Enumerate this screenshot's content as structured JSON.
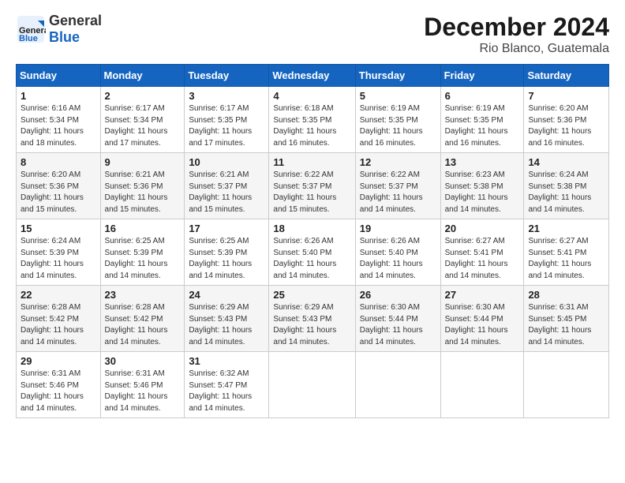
{
  "header": {
    "logo_general": "General",
    "logo_blue": "Blue",
    "title": "December 2024",
    "subtitle": "Rio Blanco, Guatemala"
  },
  "days_of_week": [
    "Sunday",
    "Monday",
    "Tuesday",
    "Wednesday",
    "Thursday",
    "Friday",
    "Saturday"
  ],
  "weeks": [
    [
      {
        "day": "1",
        "info": "Sunrise: 6:16 AM\nSunset: 5:34 PM\nDaylight: 11 hours\nand 18 minutes."
      },
      {
        "day": "2",
        "info": "Sunrise: 6:17 AM\nSunset: 5:34 PM\nDaylight: 11 hours\nand 17 minutes."
      },
      {
        "day": "3",
        "info": "Sunrise: 6:17 AM\nSunset: 5:35 PM\nDaylight: 11 hours\nand 17 minutes."
      },
      {
        "day": "4",
        "info": "Sunrise: 6:18 AM\nSunset: 5:35 PM\nDaylight: 11 hours\nand 16 minutes."
      },
      {
        "day": "5",
        "info": "Sunrise: 6:19 AM\nSunset: 5:35 PM\nDaylight: 11 hours\nand 16 minutes."
      },
      {
        "day": "6",
        "info": "Sunrise: 6:19 AM\nSunset: 5:35 PM\nDaylight: 11 hours\nand 16 minutes."
      },
      {
        "day": "7",
        "info": "Sunrise: 6:20 AM\nSunset: 5:36 PM\nDaylight: 11 hours\nand 16 minutes."
      }
    ],
    [
      {
        "day": "8",
        "info": "Sunrise: 6:20 AM\nSunset: 5:36 PM\nDaylight: 11 hours\nand 15 minutes."
      },
      {
        "day": "9",
        "info": "Sunrise: 6:21 AM\nSunset: 5:36 PM\nDaylight: 11 hours\nand 15 minutes."
      },
      {
        "day": "10",
        "info": "Sunrise: 6:21 AM\nSunset: 5:37 PM\nDaylight: 11 hours\nand 15 minutes."
      },
      {
        "day": "11",
        "info": "Sunrise: 6:22 AM\nSunset: 5:37 PM\nDaylight: 11 hours\nand 15 minutes."
      },
      {
        "day": "12",
        "info": "Sunrise: 6:22 AM\nSunset: 5:37 PM\nDaylight: 11 hours\nand 14 minutes."
      },
      {
        "day": "13",
        "info": "Sunrise: 6:23 AM\nSunset: 5:38 PM\nDaylight: 11 hours\nand 14 minutes."
      },
      {
        "day": "14",
        "info": "Sunrise: 6:24 AM\nSunset: 5:38 PM\nDaylight: 11 hours\nand 14 minutes."
      }
    ],
    [
      {
        "day": "15",
        "info": "Sunrise: 6:24 AM\nSunset: 5:39 PM\nDaylight: 11 hours\nand 14 minutes."
      },
      {
        "day": "16",
        "info": "Sunrise: 6:25 AM\nSunset: 5:39 PM\nDaylight: 11 hours\nand 14 minutes."
      },
      {
        "day": "17",
        "info": "Sunrise: 6:25 AM\nSunset: 5:39 PM\nDaylight: 11 hours\nand 14 minutes."
      },
      {
        "day": "18",
        "info": "Sunrise: 6:26 AM\nSunset: 5:40 PM\nDaylight: 11 hours\nand 14 minutes."
      },
      {
        "day": "19",
        "info": "Sunrise: 6:26 AM\nSunset: 5:40 PM\nDaylight: 11 hours\nand 14 minutes."
      },
      {
        "day": "20",
        "info": "Sunrise: 6:27 AM\nSunset: 5:41 PM\nDaylight: 11 hours\nand 14 minutes."
      },
      {
        "day": "21",
        "info": "Sunrise: 6:27 AM\nSunset: 5:41 PM\nDaylight: 11 hours\nand 14 minutes."
      }
    ],
    [
      {
        "day": "22",
        "info": "Sunrise: 6:28 AM\nSunset: 5:42 PM\nDaylight: 11 hours\nand 14 minutes."
      },
      {
        "day": "23",
        "info": "Sunrise: 6:28 AM\nSunset: 5:42 PM\nDaylight: 11 hours\nand 14 minutes."
      },
      {
        "day": "24",
        "info": "Sunrise: 6:29 AM\nSunset: 5:43 PM\nDaylight: 11 hours\nand 14 minutes."
      },
      {
        "day": "25",
        "info": "Sunrise: 6:29 AM\nSunset: 5:43 PM\nDaylight: 11 hours\nand 14 minutes."
      },
      {
        "day": "26",
        "info": "Sunrise: 6:30 AM\nSunset: 5:44 PM\nDaylight: 11 hours\nand 14 minutes."
      },
      {
        "day": "27",
        "info": "Sunrise: 6:30 AM\nSunset: 5:44 PM\nDaylight: 11 hours\nand 14 minutes."
      },
      {
        "day": "28",
        "info": "Sunrise: 6:31 AM\nSunset: 5:45 PM\nDaylight: 11 hours\nand 14 minutes."
      }
    ],
    [
      {
        "day": "29",
        "info": "Sunrise: 6:31 AM\nSunset: 5:46 PM\nDaylight: 11 hours\nand 14 minutes."
      },
      {
        "day": "30",
        "info": "Sunrise: 6:31 AM\nSunset: 5:46 PM\nDaylight: 11 hours\nand 14 minutes."
      },
      {
        "day": "31",
        "info": "Sunrise: 6:32 AM\nSunset: 5:47 PM\nDaylight: 11 hours\nand 14 minutes."
      },
      null,
      null,
      null,
      null
    ]
  ]
}
